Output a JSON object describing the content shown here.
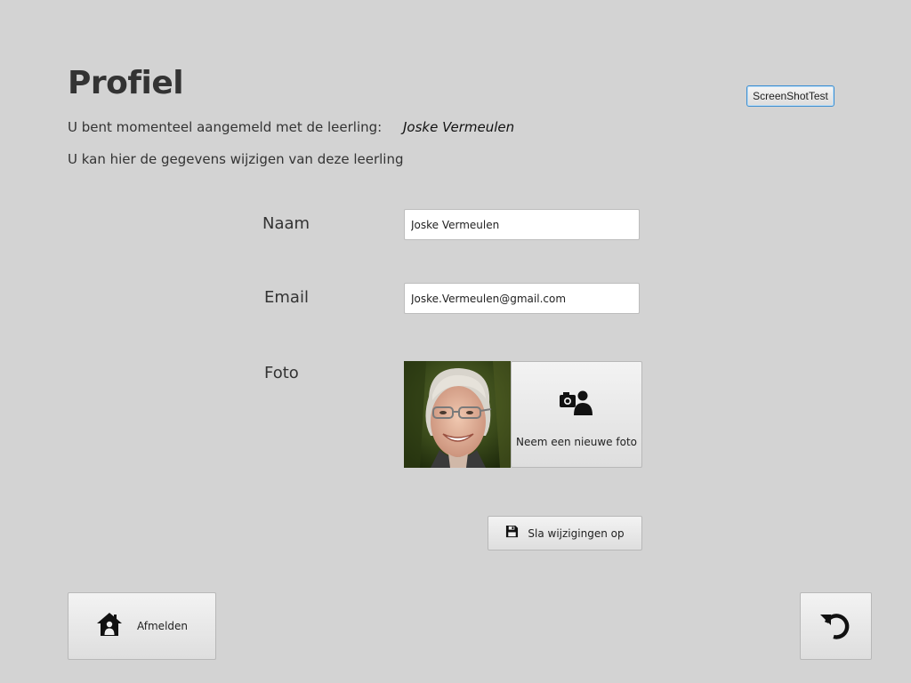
{
  "header": {
    "title": "Profiel",
    "test_button_label": "ScreenShotTest"
  },
  "info": {
    "logged_in_label": "U bent momenteel aangemeld met de leerling:",
    "student_name": "Joske Vermeulen",
    "edit_hint": "U kan hier de gegevens wijzigen van deze leerling"
  },
  "form": {
    "name_label": "Naam",
    "name_value": "Joske Vermeulen",
    "email_label": "Email",
    "email_value": "Joske.Vermeulen@gmail.com",
    "photo_label": "Foto",
    "photo_button_label": "Neem een nieuwe foto",
    "photo_button_icon": "camera-person-icon",
    "save_button_label": "Sla wijzigingen op",
    "save_button_icon": "floppy-disk-icon"
  },
  "footer": {
    "logout_label": "Afmelden",
    "logout_icon": "home-person-icon",
    "back_icon": "undo-arrow-icon"
  },
  "colors": {
    "background": "#d3d3d3",
    "text": "#333333",
    "focus_border": "#3f8fd0"
  }
}
